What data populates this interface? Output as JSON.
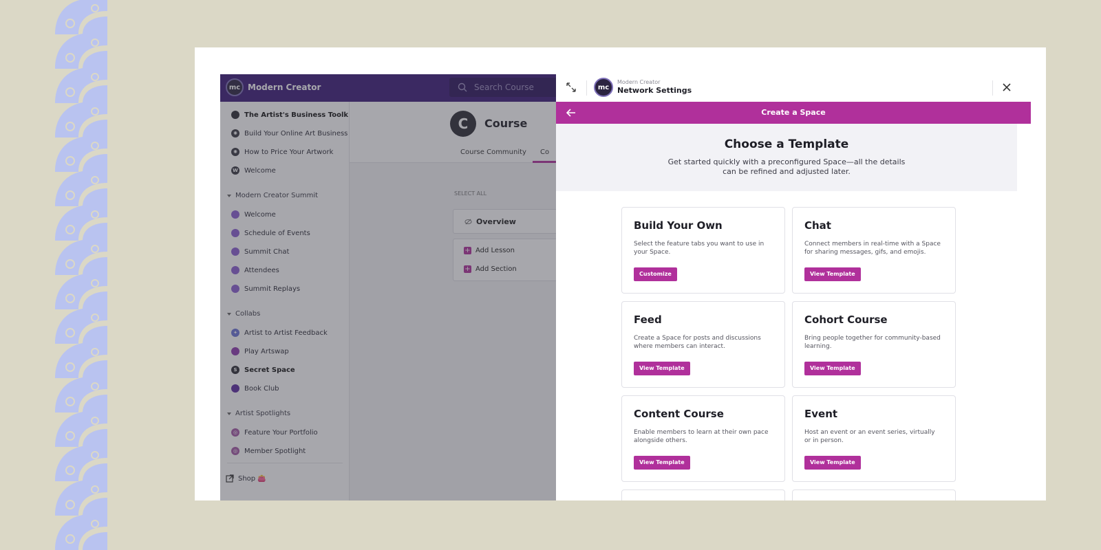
{
  "app": {
    "brand_logo": "mc",
    "brand_name": "Modern Creator",
    "search_placeholder": "Search Course"
  },
  "sidebar": {
    "items": [
      {
        "label": "The Artist's Business Toolkit",
        "icon": "dark-dot",
        "bold": true
      },
      {
        "label": "Build Your Online Art Business",
        "icon": "dark-dot"
      },
      {
        "label": "How to Price Your Artwork",
        "icon": "dark-dot"
      },
      {
        "label": "Welcome",
        "icon": "W"
      }
    ],
    "groups": [
      {
        "label": "Modern Creator Summit",
        "items": [
          "Welcome",
          "Schedule of Events",
          "Summit Chat",
          "Attendees",
          "Summit Replays"
        ]
      },
      {
        "label": "Collabs",
        "items": [
          "Artist to Artist Feedback",
          "Play Artswap",
          "Secret Space",
          "Book Club"
        ]
      },
      {
        "label": "Artist Spotlights",
        "items": [
          "Feature Your Portfolio",
          "Member Spotlight"
        ]
      }
    ],
    "secret_space_initial": "S",
    "shop_label": "Shop 👛"
  },
  "course": {
    "icon_letter": "C",
    "title": "Course",
    "tabs": [
      "Course Community",
      "Co"
    ],
    "select_all": "SELECT ALL",
    "overview": "Overview",
    "add_lesson": "Add Lesson",
    "add_section": "Add Section"
  },
  "modal": {
    "org_small": "Modern Creator",
    "header_title": "Network Settings",
    "bar_title": "Create a Space",
    "heading": "Choose a Template",
    "subheading": "Get started quickly with a preconfigured Space—all the details can be refined and adjusted later.",
    "cards": [
      {
        "title": "Build Your Own",
        "desc": "Select the feature tabs you want to use in your Space.",
        "button": "Customize"
      },
      {
        "title": "Chat",
        "desc": "Connect members in real-time with a Space for sharing messages, gifs, and emojis.",
        "button": "View Template"
      },
      {
        "title": "Feed",
        "desc": "Create a Space for posts and discussions where members can interact.",
        "button": "View Template"
      },
      {
        "title": "Cohort Course",
        "desc": "Bring people together for community-based learning.",
        "button": "View Template"
      },
      {
        "title": "Content Course",
        "desc": "Enable members to learn at their own pace alongside others.",
        "button": "View Template"
      },
      {
        "title": "Event",
        "desc": "Host an event or an event series, virtually or in person.",
        "button": "View Template"
      }
    ]
  },
  "colors": {
    "accent": "#b0309b",
    "topbar": "#3b1b79",
    "background": "#dbd8c6",
    "decor": "#b9c3f0"
  }
}
